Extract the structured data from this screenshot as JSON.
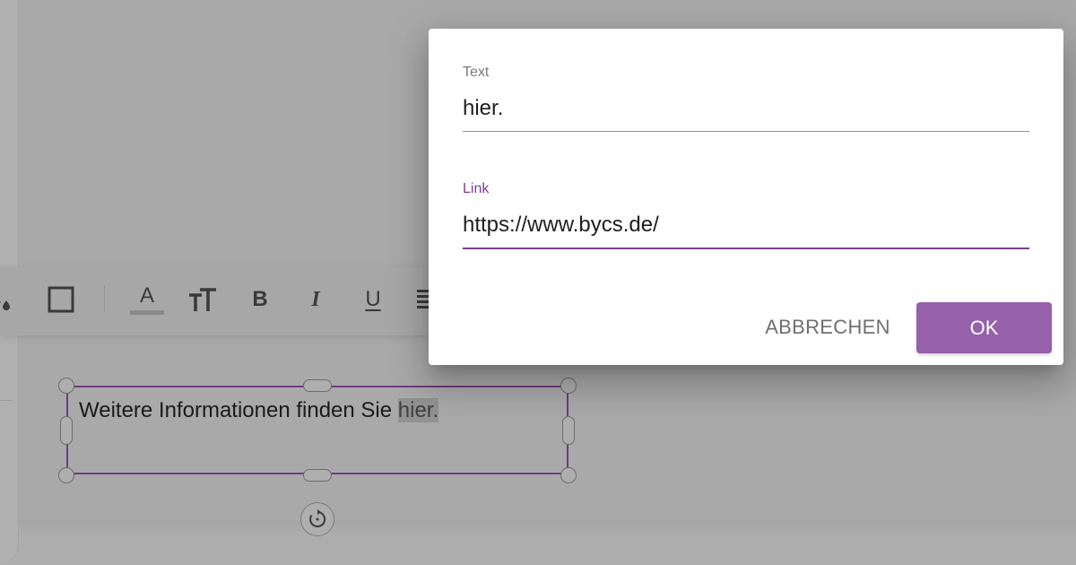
{
  "toolbar": {
    "items": [
      {
        "name": "fill-color-icon"
      },
      {
        "name": "border-icon"
      },
      {
        "name": "font-color-icon",
        "glyph": "A"
      },
      {
        "name": "font-size-icon"
      },
      {
        "name": "bold-icon",
        "glyph": "B"
      },
      {
        "name": "italic-icon",
        "glyph": "I"
      },
      {
        "name": "underline-icon",
        "glyph": "U"
      },
      {
        "name": "align-icon"
      }
    ]
  },
  "textbox": {
    "text_before": "Weitere Informationen finden Sie ",
    "text_highlight": "hier."
  },
  "dialog": {
    "text_field": {
      "label": "Text",
      "value": "hier."
    },
    "link_field": {
      "label": "Link",
      "value": "https://www.bycs.de/"
    },
    "cancel_label": "ABBRECHEN",
    "ok_label": "OK"
  },
  "colors": {
    "accent": "#9660ab",
    "focus": "#7a3f8e",
    "overlay": "#adadad"
  }
}
